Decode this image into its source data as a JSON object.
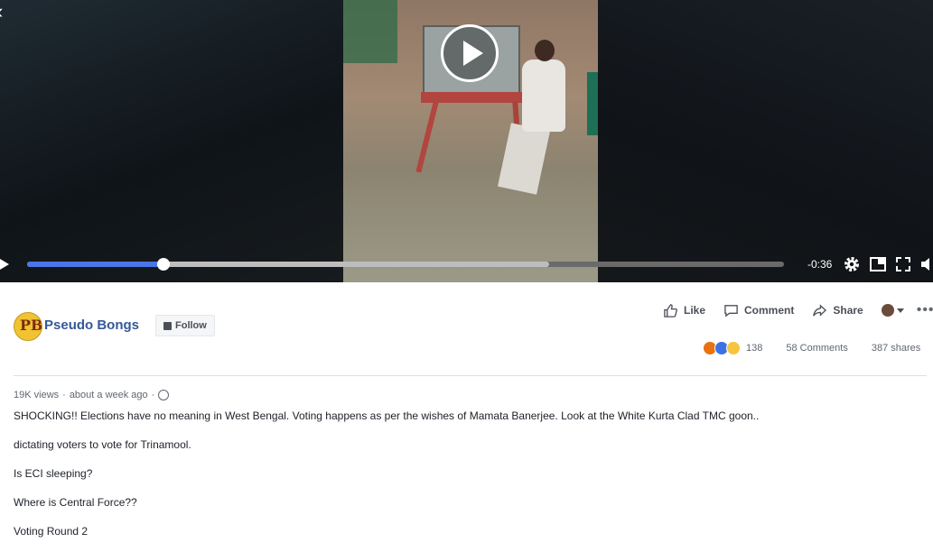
{
  "video": {
    "time_remaining": "-0:36",
    "progress_fraction": 0.18,
    "buffered_fraction": 0.69,
    "icons": [
      "back-chevron-icon",
      "play-icon",
      "settings-gear-icon",
      "picture-in-picture-icon",
      "fullscreen-icon",
      "volume-icon"
    ]
  },
  "page": {
    "avatar_text": "PB",
    "name": "Pseudo Bongs",
    "follow_label": "Follow"
  },
  "actions": {
    "like": "Like",
    "comment": "Comment",
    "share": "Share",
    "more": "•••"
  },
  "stats": {
    "reaction_count": "138",
    "comments": "58 Comments",
    "shares": "387 shares"
  },
  "meta": {
    "views": "19K views",
    "separator": "·",
    "time": "about a week ago",
    "separator2": "·"
  },
  "post": {
    "paragraphs": [
      "SHOCKING!! Elections have no meaning in West Bengal. Voting happens as per the wishes of Mamata Banerjee. Look at the White Kurta Clad TMC goon..",
      "dictating voters to vote for Trinamool.",
      "Is ECI sleeping?",
      "Where is Central Force??",
      "Voting Round 2"
    ]
  },
  "colors": {
    "link_blue": "#365899",
    "progress_blue": "#4a76e8",
    "text_dark": "#1d2129",
    "text_muted": "#606770"
  }
}
